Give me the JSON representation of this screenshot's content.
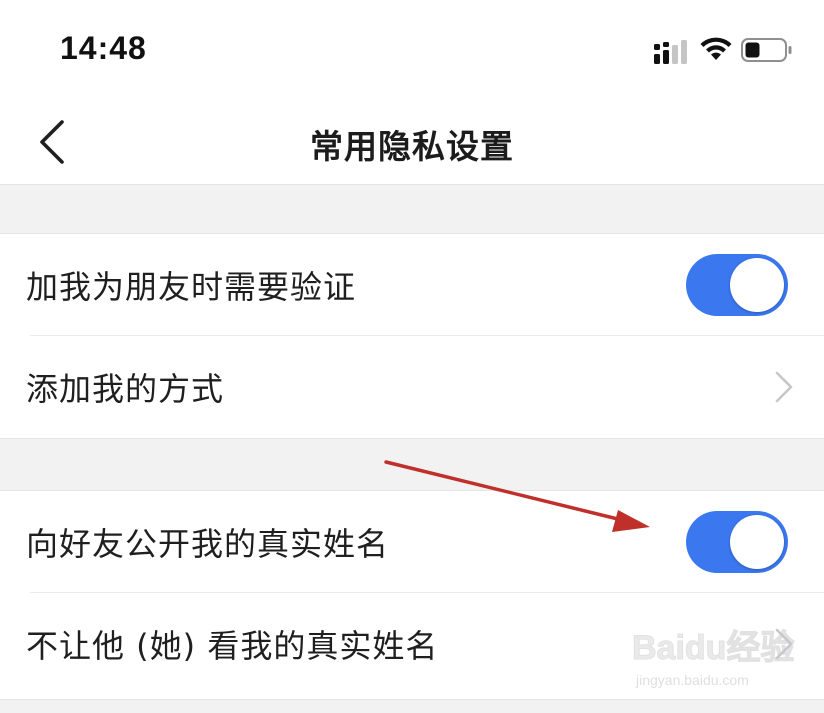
{
  "status_bar": {
    "time": "14:48",
    "icons": [
      "cellular-signal-icon",
      "wifi-icon",
      "battery-icon"
    ]
  },
  "nav": {
    "back_icon": "chevron-left-icon",
    "title": "常用隐私设置"
  },
  "sections": [
    {
      "rows": [
        {
          "label": "加我为朋友时需要验证",
          "control": "toggle",
          "on": true
        },
        {
          "label": "添加我的方式",
          "control": "chevron"
        }
      ]
    },
    {
      "rows": [
        {
          "label": "向好友公开我的真实姓名",
          "control": "toggle",
          "on": true
        },
        {
          "label": "不让他 (她) 看我的真实姓名",
          "control": "chevron"
        }
      ]
    }
  ],
  "annotation": {
    "type": "arrow",
    "color": "#c0302a",
    "points_to": "向好友公开我的真实姓名 toggle"
  },
  "watermark": {
    "brand": "Baidu经验",
    "url": "jingyan.baidu.com"
  },
  "colors": {
    "toggle_on": "#3b78f0",
    "background": "#f2f2f3",
    "row_background": "#ffffff",
    "chevron": "#c7c7cc"
  }
}
